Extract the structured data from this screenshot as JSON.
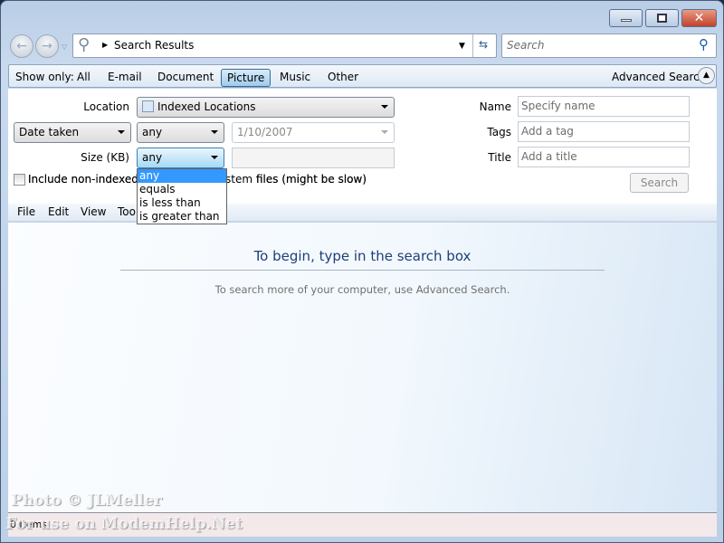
{
  "window": {
    "minimize": "minimize",
    "maximize": "maximize",
    "close": "close"
  },
  "nav": {
    "breadcrumb": "Search Results",
    "search_placeholder": "Search"
  },
  "show_only": {
    "label": "Show only:",
    "tabs": [
      "All",
      "E-mail",
      "Document",
      "Picture",
      "Music",
      "Other"
    ],
    "selected": "Picture",
    "advanced": "Advanced Search"
  },
  "advanced": {
    "location_label": "Location",
    "location_value": "Indexed Locations",
    "date_field": "Date taken",
    "date_op": "any",
    "date_value": "1/10/2007",
    "size_label": "Size (KB)",
    "size_op": "any",
    "size_value": "",
    "size_options": [
      "any",
      "equals",
      "is less than",
      "is greater than"
    ],
    "include_label": "Include non-indexed, hidden, and system files (might be slow)",
    "include_visible_left": "Include non-indexed, H",
    "include_visible_right": "files (might be slow)",
    "name_label": "Name",
    "name_placeholder": "Specify name",
    "tags_label": "Tags",
    "tags_placeholder": "Add a tag",
    "title_label": "Title",
    "title_placeholder": "Add a title",
    "search_button": "Search"
  },
  "menu": [
    "File",
    "Edit",
    "View",
    "Too"
  ],
  "content": {
    "heading": "To begin, type in the search box",
    "sub": "To search more of your computer, use Advanced Search."
  },
  "status": {
    "items": "0 items"
  },
  "watermark": {
    "line1": "Photo © JLMeller",
    "line2": "For use on ModemHelp.Net"
  }
}
